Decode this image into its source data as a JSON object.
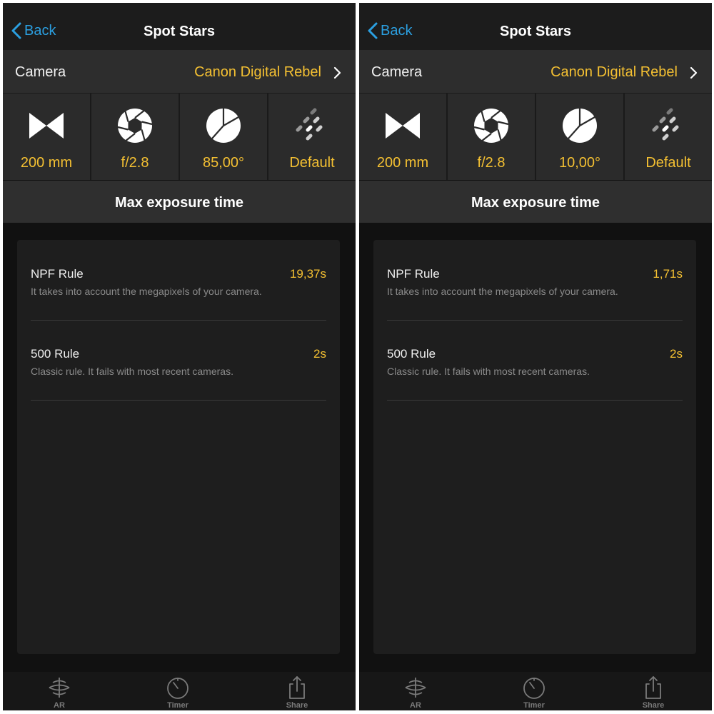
{
  "colors": {
    "accent": "#f4c032",
    "link": "#2b9fe0"
  },
  "screens": [
    {
      "nav": {
        "back": "Back",
        "title": "Spot Stars"
      },
      "camera": {
        "label": "Camera",
        "value": "Canon Digital Rebel"
      },
      "params": [
        {
          "icon": "focal-length-icon",
          "value": "200 mm"
        },
        {
          "icon": "aperture-icon",
          "value": "f/2.8"
        },
        {
          "icon": "declination-icon",
          "value": "85,00°"
        },
        {
          "icon": "accuracy-icon",
          "value": "Default"
        }
      ],
      "section": "Max exposure time",
      "rules": [
        {
          "name": "NPF Rule",
          "value": "19,37s",
          "desc": "It takes into account the megapixels of your camera."
        },
        {
          "name": "500 Rule",
          "value": "2s",
          "desc": "Classic rule. It fails with most recent cameras."
        }
      ],
      "tabs": [
        {
          "icon": "ar-icon",
          "label": "AR"
        },
        {
          "icon": "timer-icon",
          "label": "Timer"
        },
        {
          "icon": "share-icon",
          "label": "Share"
        }
      ]
    },
    {
      "nav": {
        "back": "Back",
        "title": "Spot Stars"
      },
      "camera": {
        "label": "Camera",
        "value": "Canon Digital Rebel"
      },
      "params": [
        {
          "icon": "focal-length-icon",
          "value": "200 mm"
        },
        {
          "icon": "aperture-icon",
          "value": "f/2.8"
        },
        {
          "icon": "declination-icon",
          "value": "10,00°"
        },
        {
          "icon": "accuracy-icon",
          "value": "Default"
        }
      ],
      "section": "Max exposure time",
      "rules": [
        {
          "name": "NPF Rule",
          "value": "1,71s",
          "desc": "It takes into account the megapixels of your camera."
        },
        {
          "name": "500 Rule",
          "value": "2s",
          "desc": "Classic rule. It fails with most recent cameras."
        }
      ],
      "tabs": [
        {
          "icon": "ar-icon",
          "label": "AR"
        },
        {
          "icon": "timer-icon",
          "label": "Timer"
        },
        {
          "icon": "share-icon",
          "label": "Share"
        }
      ]
    }
  ]
}
